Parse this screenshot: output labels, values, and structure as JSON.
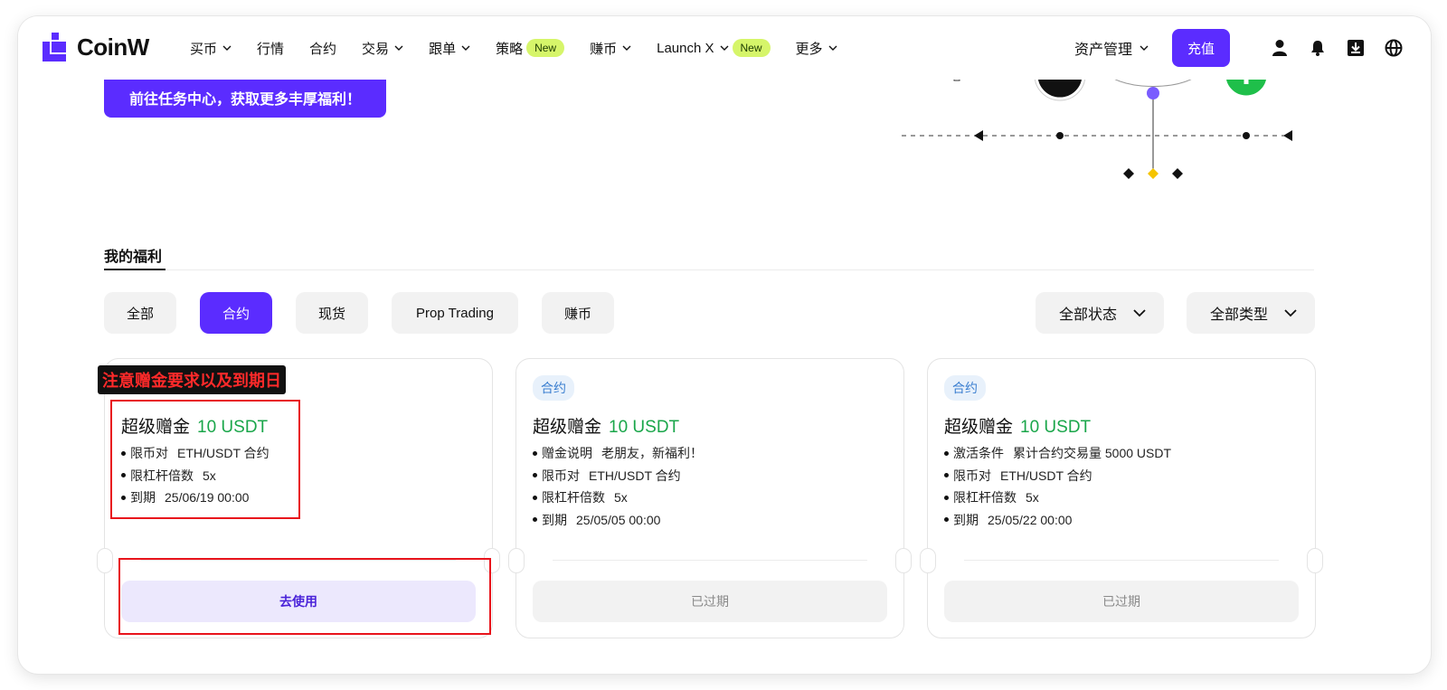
{
  "nav": {
    "logo_text": "CoinW",
    "menu": [
      {
        "label": "买币",
        "chevron": true
      },
      {
        "label": "行情",
        "chevron": false
      },
      {
        "label": "合约",
        "chevron": false
      },
      {
        "label": "交易",
        "chevron": true
      },
      {
        "label": "跟单",
        "chevron": true
      },
      {
        "label": "策略",
        "badge": "New"
      },
      {
        "label": "赚币",
        "chevron": true
      },
      {
        "label": "Launch X",
        "chevron": true,
        "badge": "New"
      },
      {
        "label": "更多",
        "chevron": true
      }
    ],
    "asset_label": "资产管理",
    "deposit_label": "充值",
    "icons": [
      "user-icon",
      "bell-icon",
      "download-icon",
      "globe-icon"
    ]
  },
  "banner": {
    "task_button": "前往任务中心，获取更多丰厚福利！"
  },
  "section": {
    "title": "我的福利"
  },
  "filters": {
    "chips": [
      "全部",
      "合约",
      "现货",
      "Prop Trading",
      "赚币"
    ],
    "active": "合约",
    "status_dropdown": "全部状态",
    "type_dropdown": "全部类型"
  },
  "annotation": {
    "label": "注意赠金要求以及到期日"
  },
  "cards": [
    {
      "tag": "",
      "title": "超级赠金",
      "amount": "10 USDT",
      "items": [
        {
          "k": "限币对",
          "v": "ETH/USDT 合约"
        },
        {
          "k": "限杠杆倍数",
          "v": "5x"
        },
        {
          "k": "到期",
          "v": "25/06/19 00:00"
        }
      ],
      "button": "去使用",
      "status": "use"
    },
    {
      "tag": "合约",
      "title": "超级赠金",
      "amount": "10 USDT",
      "items": [
        {
          "k": "赠金说明",
          "v": "老朋友，新福利！"
        },
        {
          "k": "限币对",
          "v": "ETH/USDT 合约"
        },
        {
          "k": "限杠杆倍数",
          "v": "5x"
        },
        {
          "k": "到期",
          "v": "25/05/05 00:00"
        }
      ],
      "button": "已过期",
      "status": "expired"
    },
    {
      "tag": "合约",
      "title": "超级赠金",
      "amount": "10 USDT",
      "items": [
        {
          "k": "激活条件",
          "v": "累计合约交易量  5000 USDT"
        },
        {
          "k": "限币对",
          "v": "ETH/USDT 合约"
        },
        {
          "k": "限杠杆倍数",
          "v": "5x"
        },
        {
          "k": "到期",
          "v": "25/05/22 00:00"
        }
      ],
      "button": "已过期",
      "status": "expired"
    }
  ],
  "colors": {
    "brand": "#5b2cff",
    "amount_green": "#1aa64a",
    "new_badge": "#d6f56a",
    "annotation_red": "#e8141c"
  }
}
